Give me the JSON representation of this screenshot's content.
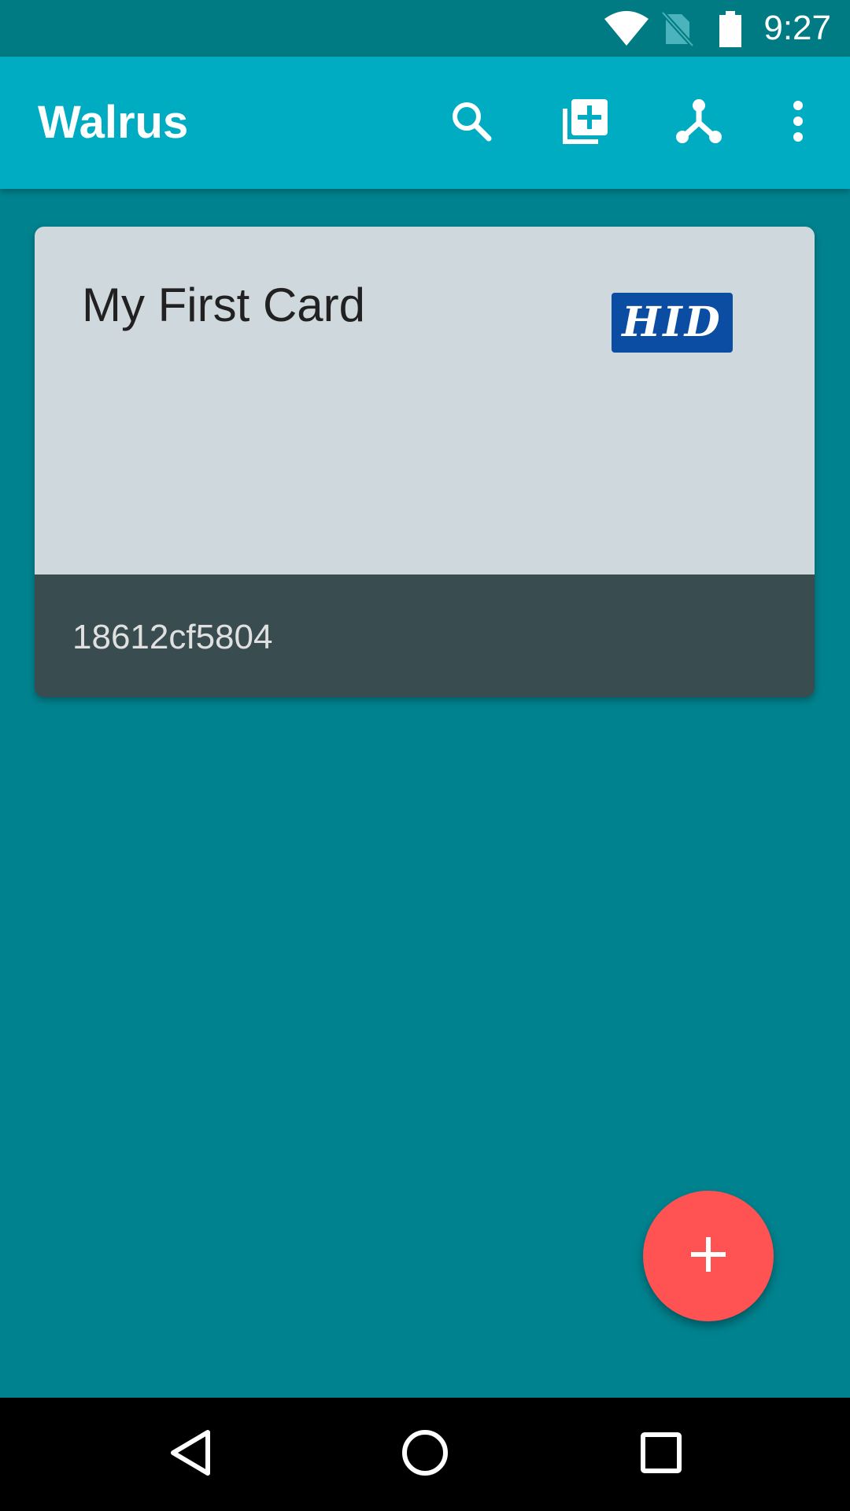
{
  "status_bar": {
    "time": "9:27",
    "icons": [
      "wifi-icon",
      "no-sim-icon",
      "battery-icon"
    ]
  },
  "app_bar": {
    "title": "Walrus",
    "actions": [
      "search-icon",
      "add-to-library-icon",
      "merge-icon",
      "more-vert-icon"
    ]
  },
  "cards": [
    {
      "title": "My First Card",
      "logo_text": "HID",
      "code": "18612cf5804"
    }
  ],
  "fab": {
    "icon": "plus-icon"
  },
  "nav_bar": {
    "icons": [
      "back-icon",
      "home-icon",
      "recents-icon"
    ]
  },
  "colors": {
    "status_bar": "#007b83",
    "app_bar": "#00acc1",
    "background": "#00838f",
    "card_top": "#cfd8dc",
    "card_bottom": "#394d51",
    "hid_blue": "#0a4da2",
    "fab": "#ff5252"
  }
}
